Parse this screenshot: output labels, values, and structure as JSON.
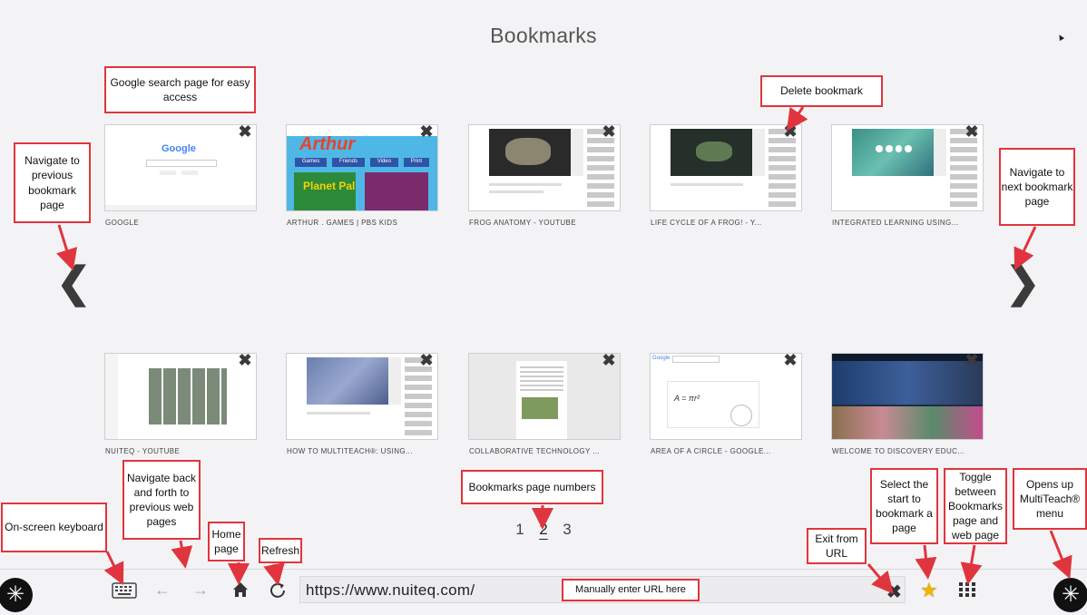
{
  "page_title": "Bookmarks",
  "bookmarks": [
    {
      "label": "GOOGLE"
    },
    {
      "label": "ARTHUR . GAMES | PBS KIDS"
    },
    {
      "label": "FROG ANATOMY - YOUTUBE"
    },
    {
      "label": "LIFE CYCLE OF A FROG! - Y..."
    },
    {
      "label": "INTEGRATED LEARNING USING..."
    },
    {
      "label": "NUITEQ - YOUTUBE"
    },
    {
      "label": "HOW TO MULTITEACH®: USING..."
    },
    {
      "label": "COLLABORATIVE TECHNOLOGY ..."
    },
    {
      "label": "AREA OF A CIRCLE - GOOGLE..."
    },
    {
      "label": "WELCOME TO DISCOVERY EDUC..."
    }
  ],
  "thumb_text": {
    "google_logo": "Google",
    "arthur_logo": "Arthur",
    "arthur_tabs": [
      "Games",
      "Friends",
      "Video",
      "Print"
    ],
    "planet_pal": "Planet Pal",
    "circle_formula": "A = πr²"
  },
  "pagination": {
    "pages": [
      "1",
      "2",
      "3"
    ],
    "current": "2"
  },
  "toolbar": {
    "url": "https://www.nuiteq.com/",
    "back_icon": "←",
    "forward_icon": "→"
  },
  "annotations": {
    "google_search": "Google search page for easy access",
    "delete_bookmark": "Delete bookmark",
    "nav_prev": "Navigate to previous bookmark page",
    "nav_next": "Navigate to next bookmark page",
    "page_numbers": "Bookmarks page numbers",
    "onscreen_keyboard": "On-screen keyboard",
    "nav_back_forth": "Navigate back and forth to previous web pages",
    "home_page": "Home page",
    "refresh": "Refresh",
    "manual_url": "Manually enter URL here",
    "exit_url": "Exit from URL",
    "select_start": "Select the start to bookmark a page",
    "toggle": "Toggle between Bookmarks page and web page",
    "menu": "Opens up MultiTeach® menu"
  },
  "colors": {
    "annotation_border": "#e0353e",
    "star": "#f0b400"
  }
}
